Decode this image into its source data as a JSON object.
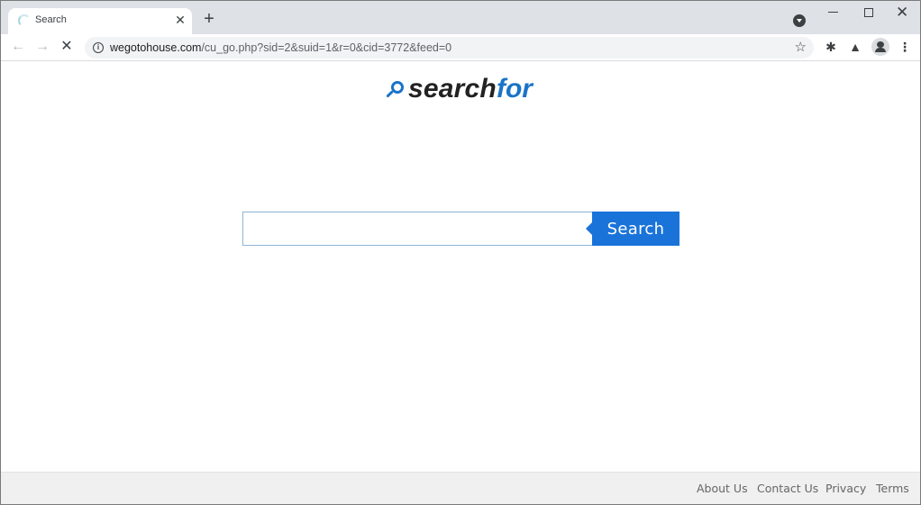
{
  "browser": {
    "tab": {
      "title": "Search",
      "loading": true
    },
    "new_tab_label": "+",
    "address_bar": {
      "host": "wegotohouse.com",
      "path": "/cu_go.php?sid=2&suid=1&r=0&cid=3772&feed=0"
    },
    "icons": {
      "back": "←",
      "forward": "→",
      "stop": "✕",
      "info": "i",
      "star": "☆",
      "extensions": "✱",
      "labs": "▲",
      "menu": "⋮",
      "tab_close": "✕",
      "window_close": "✕"
    }
  },
  "page": {
    "logo": {
      "part1": "search",
      "part2": "for",
      "accent_color": "#1a73c8"
    },
    "search": {
      "value": "",
      "placeholder": "",
      "button_label": "Search",
      "button_color": "#1a73d9"
    },
    "footer": {
      "links": [
        "About Us",
        "Contact Us",
        "Privacy",
        "Terms"
      ]
    }
  }
}
